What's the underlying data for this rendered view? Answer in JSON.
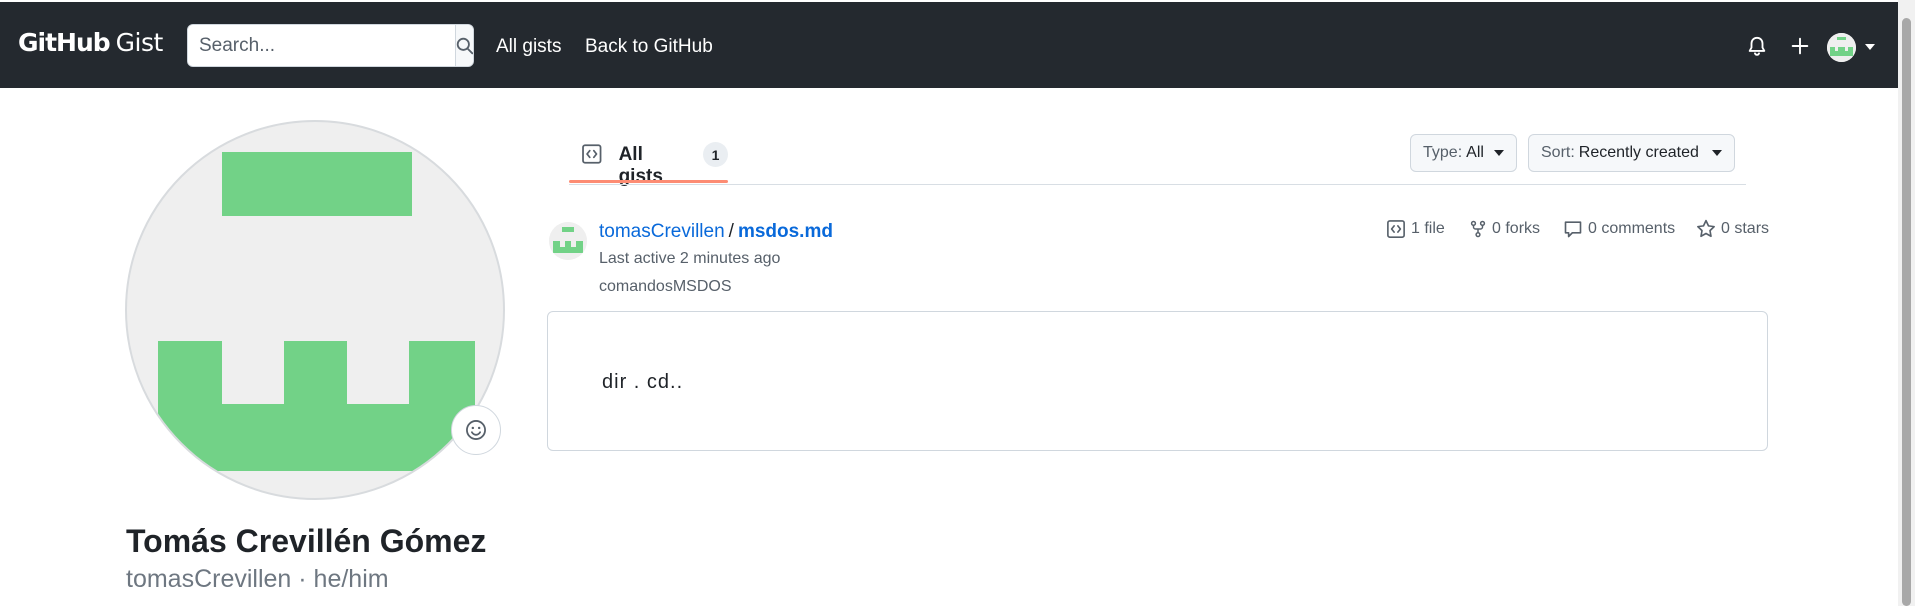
{
  "header": {
    "logo_github": "GitHub",
    "logo_gist": "Gist",
    "search_placeholder": "Search...",
    "nav": [
      {
        "label": "All gists"
      },
      {
        "label": "Back to GitHub"
      }
    ],
    "icons": [
      "search-icon",
      "bell-icon",
      "plus-icon",
      "avatar",
      "caret-down-icon"
    ],
    "background_color": "#24292f"
  },
  "profile": {
    "name": "Tomás Crevillén Gómez",
    "username_pronouns": "tomasCrevillen · he/him",
    "avatar_color": "#72d287",
    "status_icon": "smiley-icon"
  },
  "tabs": [
    {
      "label": "All gists",
      "count": "1",
      "icon": "code-square-icon",
      "selected": true
    }
  ],
  "filters": {
    "type_label": "Type:",
    "type_value": "All",
    "sort_label": "Sort:",
    "sort_value": "Recently created"
  },
  "gist": {
    "owner": "tomasCrevillen",
    "separator": "/",
    "filename": "msdos.md",
    "last_active": "Last active 2 minutes ago",
    "description": "comandosMSDOS",
    "meta": {
      "files": "1 file",
      "forks": "0 forks",
      "comments": "0 comments",
      "stars": "0 stars"
    },
    "preview": "dir . cd.."
  },
  "colors": {
    "accent_link": "#0969da",
    "tab_underline": "#fd8c73",
    "muted": "#57606a"
  }
}
